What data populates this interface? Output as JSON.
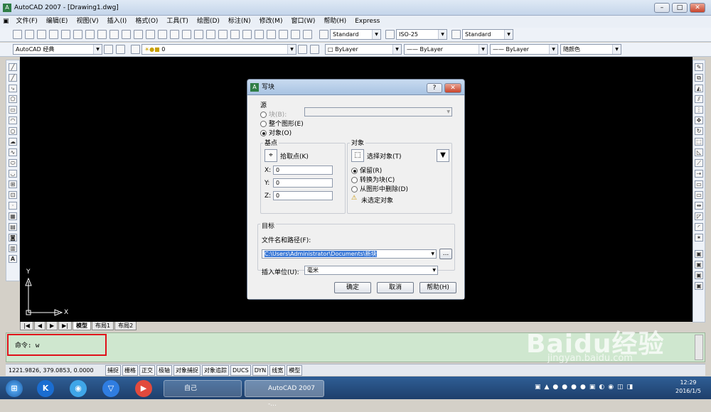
{
  "window": {
    "title": "AutoCAD 2007 - [Drawing1.dwg]",
    "minimize": "–",
    "maximize": "□",
    "close": "✕"
  },
  "menu": [
    "文件(F)",
    "编辑(E)",
    "视图(V)",
    "插入(I)",
    "格式(O)",
    "工具(T)",
    "绘图(D)",
    "标注(N)",
    "修改(M)",
    "窗口(W)",
    "帮助(H)",
    "Express"
  ],
  "toolbar1": {
    "text_style": "Standard",
    "dim_style": "ISO-25",
    "table_style": "Standard"
  },
  "toolbar2": {
    "workspace": "AutoCAD 经典",
    "layer": "0",
    "color": "ByLayer",
    "linetype": "ByLayer",
    "lineweight": "ByLayer",
    "plotstyle": "随颜色"
  },
  "ucs": {
    "x": "X",
    "y": "Y"
  },
  "layout_tabs": [
    "模型",
    "布局1",
    "布局2"
  ],
  "command": {
    "line": "命令: w"
  },
  "status": {
    "coords": "1221.9826, 379.0853, 0.0000",
    "buttons": [
      "捕捉",
      "栅格",
      "正交",
      "极轴",
      "对象捕捉",
      "对象追踪",
      "DUCS",
      "DYN",
      "线宽",
      "模型"
    ]
  },
  "dialog": {
    "title": "写块",
    "help_btn": "?",
    "source_label": "源",
    "source_options": [
      "块(B):",
      "整个图形(E)",
      "对象(O)"
    ],
    "base_label": "基点",
    "pick_point": "拾取点(K)",
    "x_label": "X:",
    "x_value": "0",
    "y_label": "Y:",
    "y_value": "0",
    "z_label": "Z:",
    "z_value": "0",
    "object_label": "对象",
    "select_objects": "选择对象(T)",
    "object_options": [
      "保留(R)",
      "转换为块(C)",
      "从图形中删除(D)"
    ],
    "warning": "未选定对象",
    "target_label": "目标",
    "filename_label": "文件名和路径(F):",
    "filename_value": "C:\\Users\\Administrator\\Documents\\新块",
    "browse": "...",
    "units_label": "插入单位(U):",
    "units_value": "毫米",
    "ok": "确定",
    "cancel": "取消",
    "help": "帮助(H)"
  },
  "taskbar": {
    "apps": [
      "自己",
      "AutoCAD 2007 -..."
    ],
    "time": "12:29",
    "date": "2016/1/5"
  },
  "watermark": {
    "text": "Baidu经验",
    "url": "jingyan.baidu.com"
  }
}
